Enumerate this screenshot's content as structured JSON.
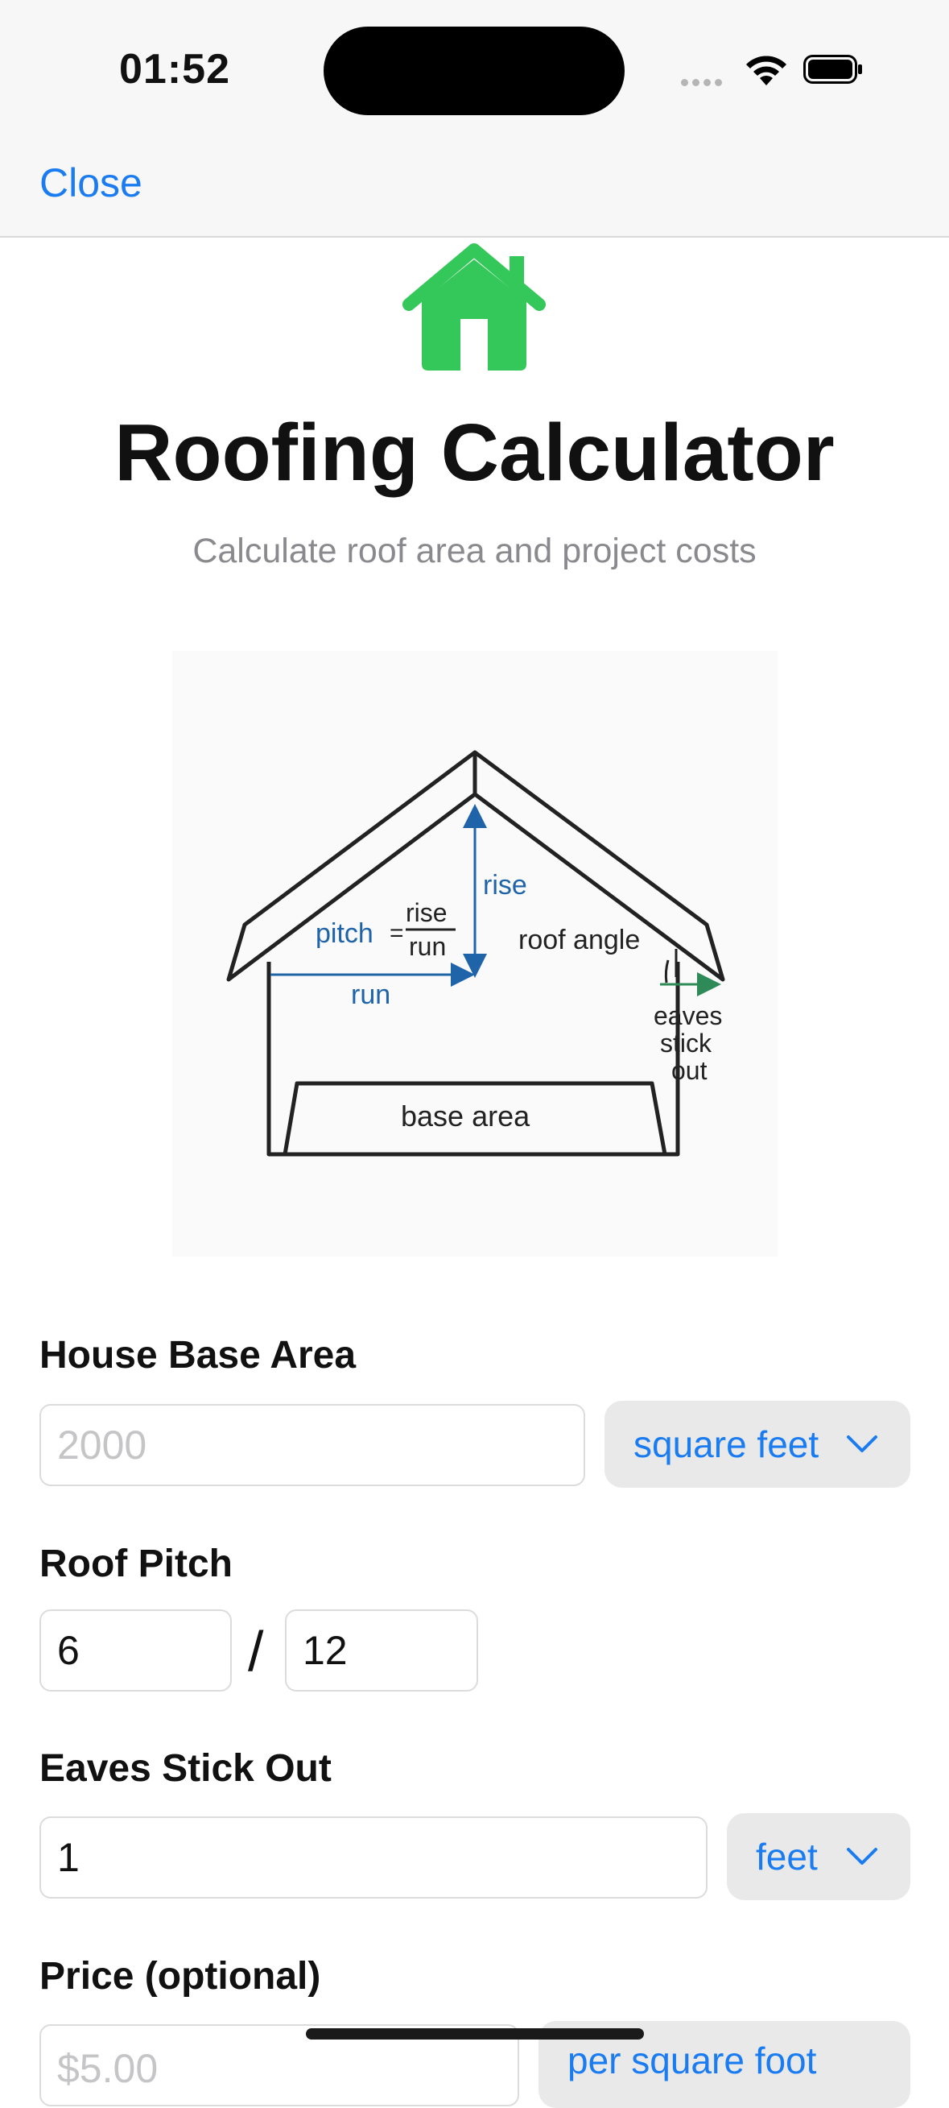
{
  "status_bar": {
    "time": "01:52"
  },
  "nav": {
    "close_label": "Close"
  },
  "header": {
    "title": "Roofing Calculator",
    "subtitle": "Calculate roof area and project costs",
    "icon": "house-icon",
    "accent": "#34c759"
  },
  "diagram": {
    "pitch_label": "pitch",
    "equals": "=",
    "rise_label": "rise",
    "run_label": "run",
    "rise_arrow_label": "rise",
    "run_arrow_label": "run",
    "roof_angle_label": "roof angle",
    "eaves_line1": "eaves",
    "eaves_line2": "stick",
    "eaves_line3": "out",
    "base_area_label": "base area"
  },
  "form": {
    "base_area": {
      "label": "House Base Area",
      "placeholder": "2000",
      "unit": "square feet"
    },
    "roof_pitch": {
      "label": "Roof Pitch",
      "rise": "6",
      "separator": "/",
      "run": "12"
    },
    "eaves": {
      "label": "Eaves Stick Out",
      "value": "1",
      "unit": "feet"
    },
    "price": {
      "label": "Price (optional)",
      "placeholder": "$5.00",
      "unit": "per square foot"
    }
  },
  "colors": {
    "link": "#1a7cf0",
    "diagram_blue": "#1f63a8",
    "diagram_green": "#2e8a57"
  }
}
